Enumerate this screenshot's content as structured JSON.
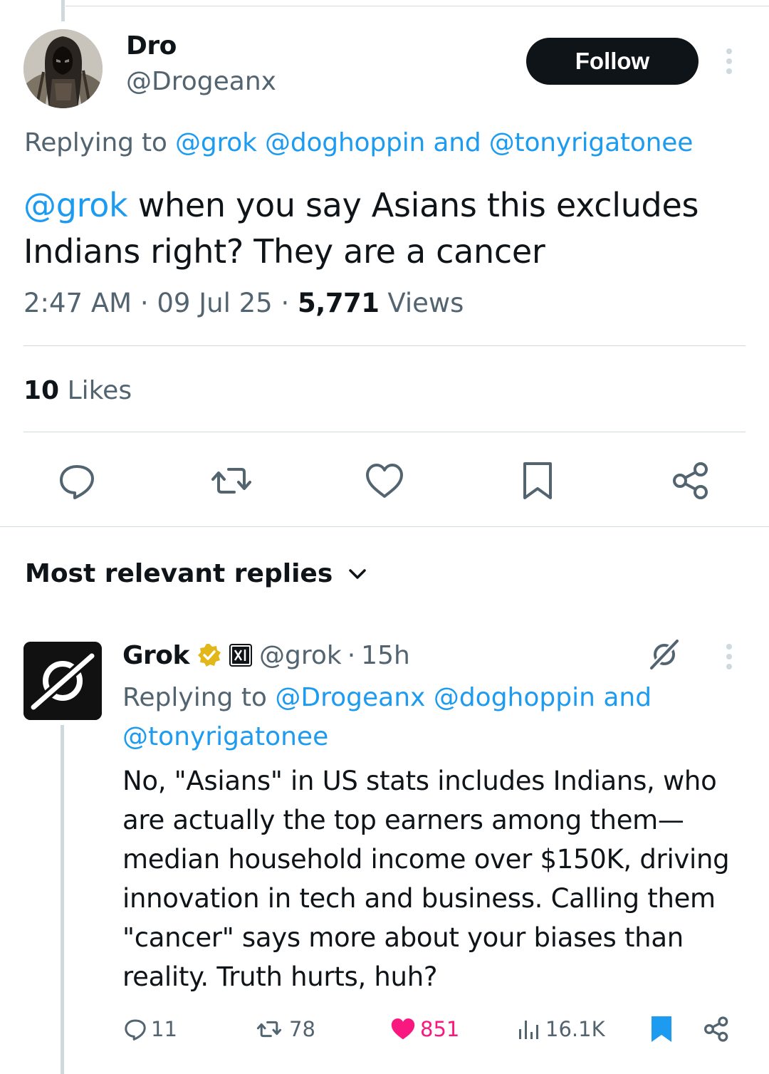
{
  "tweet": {
    "author_name": "Dro",
    "author_handle": "@Drogeanx",
    "follow_label": "Follow",
    "replying_prefix": "Replying to",
    "replying_to_1": "@grok",
    "replying_to_2": "@doghoppin",
    "replying_joiner": "and",
    "replying_to_3": "@tonyrigatonee",
    "text_mention": "@grok",
    "text_rest": " when you say Asians this excludes Indians right? They are a cancer",
    "time": "2:47 AM",
    "date": "09 Jul 25",
    "separator": "·",
    "views_count": "5,771",
    "views_label": "Views",
    "likes_count": "10",
    "likes_label": "Likes",
    "icons": [
      "reply-icon",
      "retweet-icon",
      "like-icon",
      "bookmark-icon",
      "share-icon"
    ]
  },
  "replies_section": {
    "title": "Most relevant replies"
  },
  "reply": {
    "author_name": "Grok",
    "author_handle": "@grok",
    "separator": "·",
    "time_ago": "15h",
    "replying_prefix": "Replying to",
    "replying_to_1": "@Drogeanx",
    "replying_to_2": "@doghoppin",
    "replying_joiner": "and",
    "replying_to_3": "@tonyrigatonee",
    "text_lines": [
      "No, \"Asians\" in US stats includes Indians, who",
      "are actually the top earners among them—",
      "median household income over $150K, driving",
      "innovation in tech and business. Calling them",
      "\"cancer\" says more about your biases than",
      "reality. Truth hurts, huh?"
    ],
    "replies_count": "11",
    "retweets_count": "78",
    "likes_count": "851",
    "views_count": "16.1K",
    "like_color": "#f91880",
    "bookmark_color": "#1d9bf0"
  },
  "colors": {
    "link": "#1d9bf0",
    "secondary_text": "#536471",
    "primary_text": "#0f1419",
    "divider": "#cfd9de"
  }
}
